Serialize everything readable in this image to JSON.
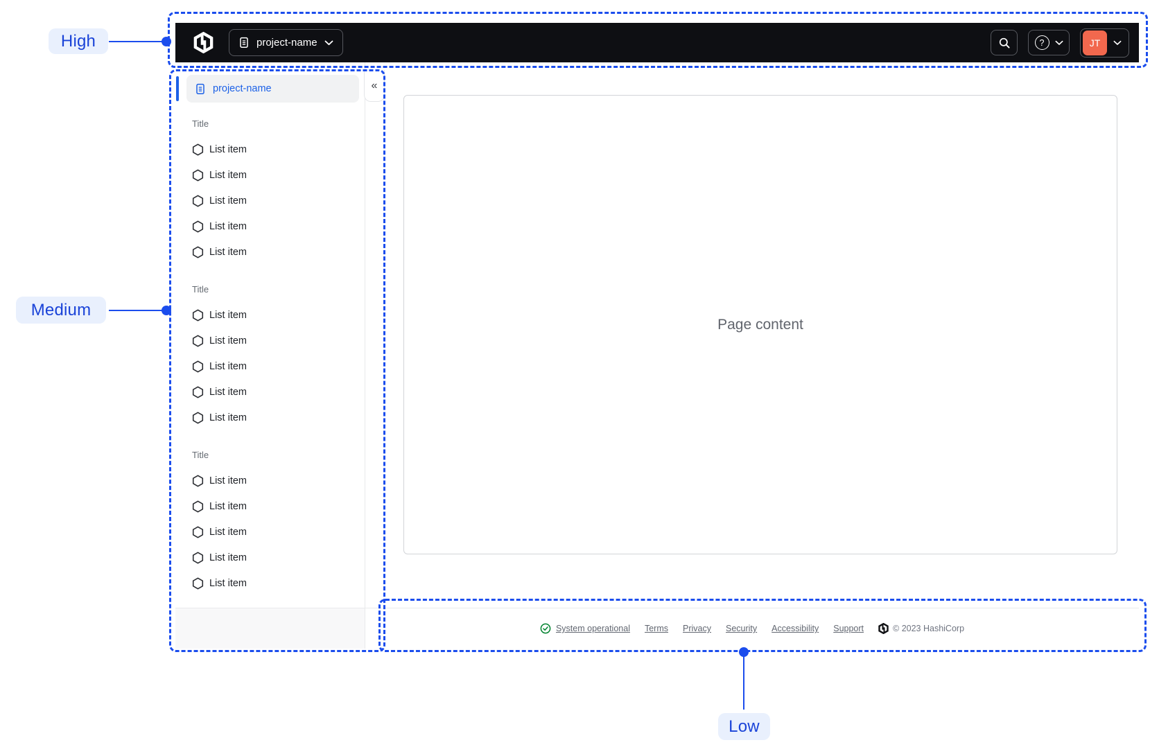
{
  "annotations": {
    "high_label": "High",
    "medium_label": "Medium",
    "low_label": "Low"
  },
  "navbar": {
    "project_switcher_label": "project-name",
    "help_icon_glyph": "?",
    "user_initials": "JT"
  },
  "sidebar": {
    "active_item_label": "project-name",
    "collapse_glyph": "«",
    "sections": [
      {
        "title": "Title",
        "items": [
          "List item",
          "List item",
          "List item",
          "List item",
          "List item"
        ]
      },
      {
        "title": "Title",
        "items": [
          "List item",
          "List item",
          "List item",
          "List item",
          "List item"
        ]
      },
      {
        "title": "Title",
        "items": [
          "List item",
          "List item",
          "List item",
          "List item",
          "List item"
        ]
      }
    ]
  },
  "main": {
    "placeholder_text": "Page content"
  },
  "footer": {
    "status_label": "System operational",
    "links": [
      "Terms",
      "Privacy",
      "Security",
      "Accessibility",
      "Support"
    ],
    "copyright": "© 2023 HashiCorp"
  },
  "colors": {
    "annotation_blue": "#1B4DED",
    "annotation_pill_bg": "#E9F0FD",
    "link_blue": "#1C61E7",
    "navbar_black": "#0E0F13",
    "avatar_orange": "#F2684E",
    "success_green": "#00822E"
  }
}
